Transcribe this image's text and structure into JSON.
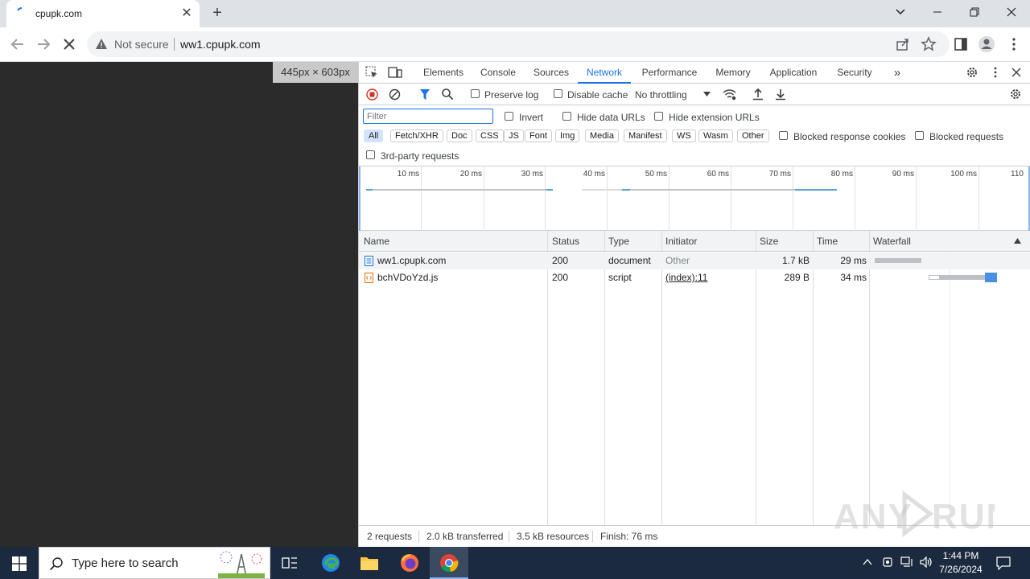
{
  "browser": {
    "tab_title": "cpupk.com",
    "tab_close": "✕",
    "new_tab": "+",
    "security_label": "Not secure",
    "url": "ww1.cpupk.com"
  },
  "page": {
    "dimensions_badge": "445px × 603px"
  },
  "devtools": {
    "tabs": [
      "Elements",
      "Console",
      "Sources",
      "Network",
      "Performance",
      "Memory",
      "Application",
      "Security"
    ],
    "active_tab": "Network",
    "more_tabs": "»",
    "network_toolbar": {
      "preserve_log": "Preserve log",
      "disable_cache": "Disable cache",
      "throttling": "No throttling"
    },
    "filter": {
      "placeholder": "Filter",
      "invert": "Invert",
      "hide_data_urls": "Hide data URLs",
      "hide_extension_urls": "Hide extension URLs",
      "types": [
        "All",
        "Fetch/XHR",
        "Doc",
        "CSS",
        "JS",
        "Font",
        "Img",
        "Media",
        "Manifest",
        "WS",
        "Wasm",
        "Other"
      ],
      "active_type": "All",
      "blocked_response_cookies": "Blocked response cookies",
      "blocked_requests": "Blocked requests",
      "third_party": "3rd-party requests"
    },
    "overview": {
      "ticks": [
        "10 ms",
        "20 ms",
        "30 ms",
        "40 ms",
        "50 ms",
        "60 ms",
        "70 ms",
        "80 ms",
        "90 ms",
        "100 ms",
        "110"
      ]
    },
    "table": {
      "columns": [
        "Name",
        "Status",
        "Type",
        "Initiator",
        "Size",
        "Time",
        "Waterfall"
      ],
      "rows": [
        {
          "name": "ww1.cpupk.com",
          "status": "200",
          "type": "document",
          "initiator": "Other",
          "size": "1.7 kB",
          "time": "29 ms"
        },
        {
          "name": "bchVDoYzd.js",
          "status": "200",
          "type": "script",
          "initiator": "(index):11",
          "size": "289 B",
          "time": "34 ms"
        }
      ]
    },
    "status": {
      "requests": "2 requests",
      "transferred": "2.0 kB transferred",
      "resources": "3.5 kB resources",
      "finish": "Finish: 76 ms"
    }
  },
  "taskbar": {
    "search_placeholder": "Type here to search",
    "time": "1:44 PM",
    "date": "7/26/2024"
  },
  "colors": {
    "accent": "#1a73e8",
    "record": "#d93025",
    "page_bg": "#2b2b2b",
    "taskbar": "#1c2a3f"
  }
}
